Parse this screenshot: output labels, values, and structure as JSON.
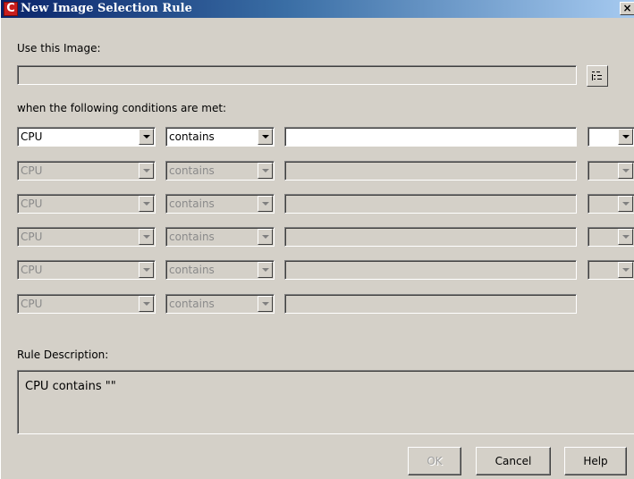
{
  "window": {
    "title": "New Image Selection Rule",
    "app_icon_letter": "C",
    "close_glyph": "×"
  },
  "image_section": {
    "label": "Use this Image:",
    "value": "",
    "browse_icon": "tree-browse-icon"
  },
  "conditions_label": "when the following conditions are met:",
  "conditions": [
    {
      "field": "CPU",
      "operator": "contains",
      "value": "",
      "connector": "",
      "enabled": true,
      "has_connector": true
    },
    {
      "field": "CPU",
      "operator": "contains",
      "value": "",
      "connector": "",
      "enabled": false,
      "has_connector": true
    },
    {
      "field": "CPU",
      "operator": "contains",
      "value": "",
      "connector": "",
      "enabled": false,
      "has_connector": true
    },
    {
      "field": "CPU",
      "operator": "contains",
      "value": "",
      "connector": "",
      "enabled": false,
      "has_connector": true
    },
    {
      "field": "CPU",
      "operator": "contains",
      "value": "",
      "connector": "",
      "enabled": false,
      "has_connector": true
    },
    {
      "field": "CPU",
      "operator": "contains",
      "value": "",
      "connector": "",
      "enabled": false,
      "has_connector": false
    }
  ],
  "description": {
    "label": "Rule Description:",
    "text": "CPU contains \"\""
  },
  "buttons": {
    "ok": "OK",
    "cancel": "Cancel",
    "help": "Help"
  }
}
